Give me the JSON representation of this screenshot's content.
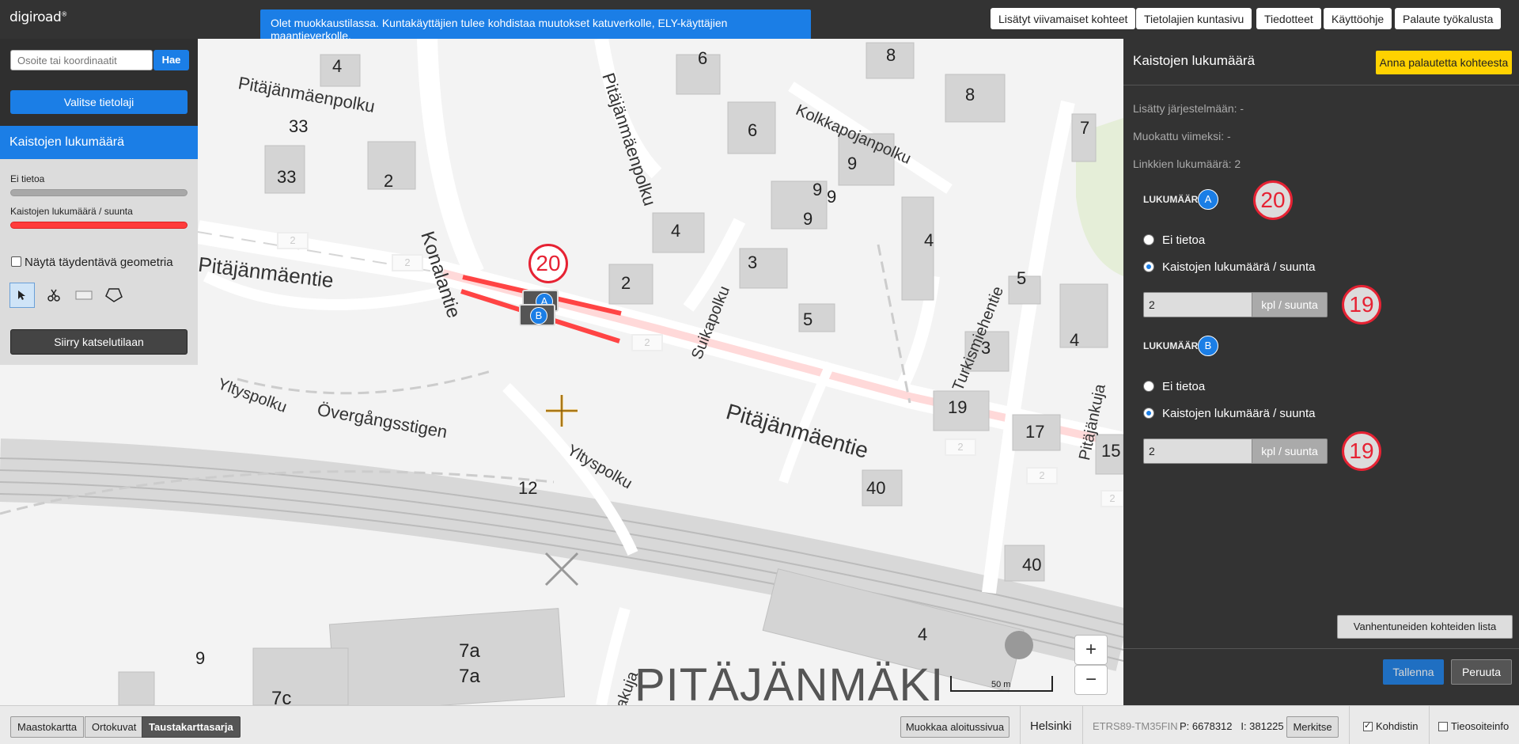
{
  "app": {
    "logo": "digiroad",
    "logo_mark": "®"
  },
  "notice": "Olet muokkaustilassa. Kuntakäyttäjien tulee kohdistaa muutokset katuverkolle, ELY-käyttäjien maantieverkolle.",
  "topnav": [
    {
      "label": "Lisätyt viivamaiset kohteet"
    },
    {
      "label": "Tietolajien kuntasivu"
    },
    {
      "label": "Tiedotteet"
    },
    {
      "label": "Käyttöohje"
    },
    {
      "label": "Palaute työkalusta"
    }
  ],
  "left_panel": {
    "search_placeholder": "Osoite tai koordinaatit",
    "search_button": "Hae",
    "select_layer_button": "Valitse tietolaji",
    "layer_title": "Kaistojen lukumäärä",
    "legend": [
      {
        "label": "Ei tietoa",
        "color": "#a8a8a8"
      },
      {
        "label": "Kaistojen lukumäärä / suunta",
        "color": "#ff3b3b"
      }
    ],
    "complementary_geometry_label": "Näytä täydentävä geometria",
    "tools": [
      {
        "name": "select-tool-icon",
        "active": true
      },
      {
        "name": "cut-tool-icon",
        "active": false
      },
      {
        "name": "rectangle-tool-icon",
        "active": false
      },
      {
        "name": "polygon-tool-icon",
        "active": false
      }
    ],
    "view_mode_button": "Siirry katselutilaan"
  },
  "map": {
    "street_labels": [
      "Pitäjänmäenpolku",
      "Konalantie",
      "Pitäjänmäenpolku",
      "Kolkkapojanpolku",
      "Pitäjänmäentie",
      "Pitäjänmäentie",
      "Suikapolku",
      "Turkismiehentie",
      "Yltyspolku",
      "Övergångsstigen",
      "Yltyspolku",
      "Pitäjänkuja",
      "Takkakuja"
    ],
    "building_numbers": [
      "4",
      "6",
      "8",
      "8",
      "33",
      "33",
      "2",
      "6",
      "7",
      "9",
      "9",
      "9",
      "9",
      "4",
      "2",
      "3",
      "5",
      "4",
      "5",
      "3",
      "4",
      "19",
      "17",
      "15",
      "40",
      "12",
      "40",
      "4",
      "9",
      "7a",
      "7a",
      "7c"
    ],
    "road_lane_badges": [
      "2",
      "2",
      "2",
      "2",
      "2",
      "2"
    ],
    "district_label": "PITÄJÄNMÄKI",
    "selected_marker_value": "20",
    "marker_a": "A",
    "marker_b": "B",
    "scale_label": "50 m",
    "zoom_in": "+",
    "zoom_out": "−"
  },
  "right_panel": {
    "title": "Kaistojen lukumäärä",
    "feedback_button": "Anna palautetta kohteesta",
    "added_label": "Lisätty järjestelmään: -",
    "modified_label": "Muokattu viimeksi: -",
    "links_label": "Linkkien lukumäärä: 2",
    "sections": [
      {
        "label": "LUKUMÄÄRÄ",
        "badge": "A",
        "marker": "20",
        "options": [
          "Ei tietoa",
          "Kaistojen lukumäärä / suunta"
        ],
        "selected_option": 1,
        "value": "2",
        "unit": "kpl / suunta",
        "value_marker": "19"
      },
      {
        "label": "LUKUMÄÄRÄ",
        "badge": "B",
        "options": [
          "Ei tietoa",
          "Kaistojen lukumäärä / suunta"
        ],
        "selected_option": 1,
        "value": "2",
        "unit": "kpl / suunta",
        "value_marker": "19"
      }
    ],
    "expired_list_button": "Vanhentuneiden kohteiden lista",
    "save_button": "Tallenna",
    "cancel_button": "Peruuta"
  },
  "bottom_bar": {
    "basemaps": [
      {
        "label": "Maastokartta",
        "active": false
      },
      {
        "label": "Ortokuvat",
        "active": false
      },
      {
        "label": "Taustakarttasarja",
        "active": true
      }
    ],
    "edit_home_button": "Muokkaa aloitussivua",
    "municipality": "Helsinki",
    "coordinate_system": "ETRS89-TM35FIN",
    "coordinates": "P: 6678312   I: 381225",
    "mark_button": "Merkitse",
    "crosshair_label": "Kohdistin",
    "crosshair_checked": true,
    "road_address_label": "Tieosoiteinfo",
    "road_address_checked": false
  }
}
